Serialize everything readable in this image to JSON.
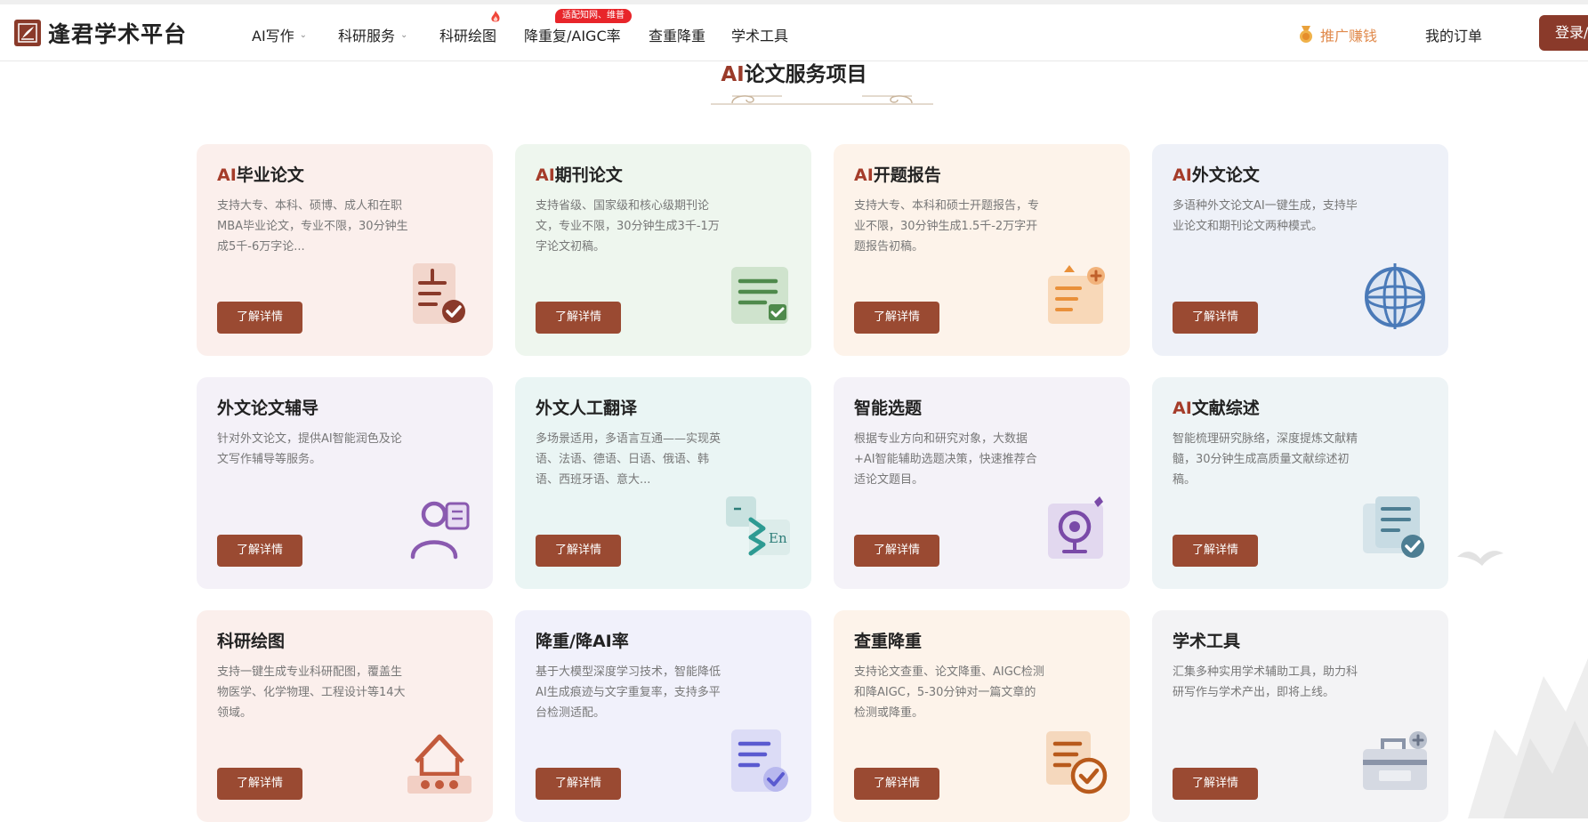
{
  "header": {
    "logo_text": "逢君学术平台",
    "nav": [
      {
        "label": "AI写作",
        "has_dropdown": true
      },
      {
        "label": "科研服务",
        "has_dropdown": true
      },
      {
        "label": "科研绘图",
        "has_dropdown": false,
        "hot": true
      },
      {
        "label": "降重复/AIGC率",
        "has_dropdown": false,
        "badge": "适配知网、维普"
      },
      {
        "label": "查重降重",
        "has_dropdown": false
      },
      {
        "label": "学术工具",
        "has_dropdown": false
      }
    ],
    "promote_label": "推广赚钱",
    "orders_label": "我的订单",
    "login_label": "登录/"
  },
  "section": {
    "title_ai": "AI",
    "title_rest": "论文服务项目"
  },
  "colors": {
    "brand": "#9a4a32",
    "accent_red": "#a53c2a",
    "promote_orange": "#e08a4c",
    "badge_red": "#e8252a"
  },
  "cards": [
    {
      "title_ai": "AI",
      "title": "毕业论文",
      "desc": "支持大专、本科、硕博、成人和在职MBA毕业论文，专业不限，30分钟生成5千-6万字论...",
      "button": "了解详情",
      "icon": "document-check-icon",
      "bg": "#fbefec"
    },
    {
      "title_ai": "AI",
      "title": "期刊论文",
      "desc": "支持省级、国家级和核心级期刊论文，专业不限，30分钟生成3千-1万字论文初稿。",
      "button": "了解详情",
      "icon": "document-lines-check-icon",
      "bg": "#eef6ee"
    },
    {
      "title_ai": "AI",
      "title": "开题报告",
      "desc": "支持大专、本科和硕士开题报告，专业不限，30分钟生成1.5千-2万字开题报告初稿。",
      "button": "了解详情",
      "icon": "report-plus-icon",
      "bg": "#fdf3ea"
    },
    {
      "title_ai": "AI",
      "title": "外文论文",
      "desc": "多语种外文论文AI一键生成，支持毕业论文和期刊论文两种模式。",
      "button": "了解详情",
      "icon": "globe-icon",
      "bg": "#eef1f8"
    },
    {
      "title_ai": "",
      "title": "外文论文辅导",
      "desc": "针对外文论文，提供AI智能润色及论文写作辅导等服务。",
      "button": "了解详情",
      "icon": "tutor-person-icon",
      "bg": "#f4f1f8"
    },
    {
      "title_ai": "",
      "title": "外文人工翻译",
      "desc": "多场景适用，多语言互通——实现英语、法语、德语、日语、俄语、韩语、西班牙语、意大...",
      "button": "了解详情",
      "icon": "translate-en-icon",
      "bg": "#eaf5f4",
      "icon_text": "En"
    },
    {
      "title_ai": "",
      "title": "智能选题",
      "desc": "根据专业方向和研究对象，大数据+AI智能辅助选题决策，快速推荐合适论文题目。",
      "button": "了解详情",
      "icon": "target-icon",
      "bg": "#f4f2f8"
    },
    {
      "title_ai": "AI",
      "title": "文献综述",
      "desc": "智能梳理研究脉络，深度提炼文献精髓，30分钟生成高质量文献综述初稿。",
      "button": "了解详情",
      "icon": "literature-check-icon",
      "bg": "#eef4f6"
    },
    {
      "title_ai": "",
      "title": "科研绘图",
      "desc": "支持一键生成专业科研配图，覆盖生物医学、化学物理、工程设计等14大领域。",
      "button": "了解详情",
      "icon": "building-icon",
      "bg": "#fbefec"
    },
    {
      "title_ai": "",
      "title": "降重/降AI率",
      "desc": "基于大模型深度学习技术，智能降低AI生成痕迹与文字重复率，支持多平台检测适配。",
      "button": "了解详情",
      "icon": "document-check-purple-icon",
      "bg": "#f1f1fb"
    },
    {
      "title_ai": "",
      "title": "查重降重",
      "desc": "支持论文查重、论文降重、AIGC检测和降AIGC，5-30分钟对一篇文章的检测或降重。",
      "button": "了解详情",
      "icon": "document-check-orange-icon",
      "bg": "#fdf3ea"
    },
    {
      "title_ai": "",
      "title": "学术工具",
      "desc": "汇集多种实用学术辅助工具，助力科研写作与学术产出，即将上线。",
      "button": "了解详情",
      "icon": "toolbox-icon",
      "bg": "#f3f3f5"
    }
  ]
}
